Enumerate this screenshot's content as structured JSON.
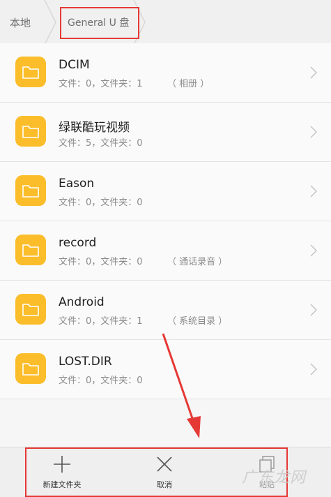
{
  "breadcrumb": {
    "root": "本地",
    "current": "General U 盘"
  },
  "colors": {
    "folder": "#fbbd2a",
    "highlight": "#e53935"
  },
  "folders": [
    {
      "name": "DCIM",
      "meta": "文件：0，文件夹：1",
      "tag": "（ 相册 ）",
      "icon": "folder-icon"
    },
    {
      "name": "绿联酷玩视频",
      "meta": "文件：5，文件夹：0",
      "tag": "",
      "icon": "folder-icon"
    },
    {
      "name": "Eason",
      "meta": "文件：0，文件夹：0",
      "tag": "",
      "icon": "folder-icon"
    },
    {
      "name": "record",
      "meta": "文件：0，文件夹：0",
      "tag": "（ 通话录音 ）",
      "icon": "folder-icon"
    },
    {
      "name": "Android",
      "meta": "文件：0，文件夹：1",
      "tag": "（ 系统目录 ）",
      "icon": "folder-icon"
    },
    {
      "name": "LOST.DIR",
      "meta": "文件：0，文件夹：0",
      "tag": "",
      "icon": "folder-icon"
    }
  ],
  "toolbar": {
    "new_folder": "新建文件夹",
    "cancel": "取消",
    "paste": "粘贴"
  },
  "watermark": "广东龙网"
}
